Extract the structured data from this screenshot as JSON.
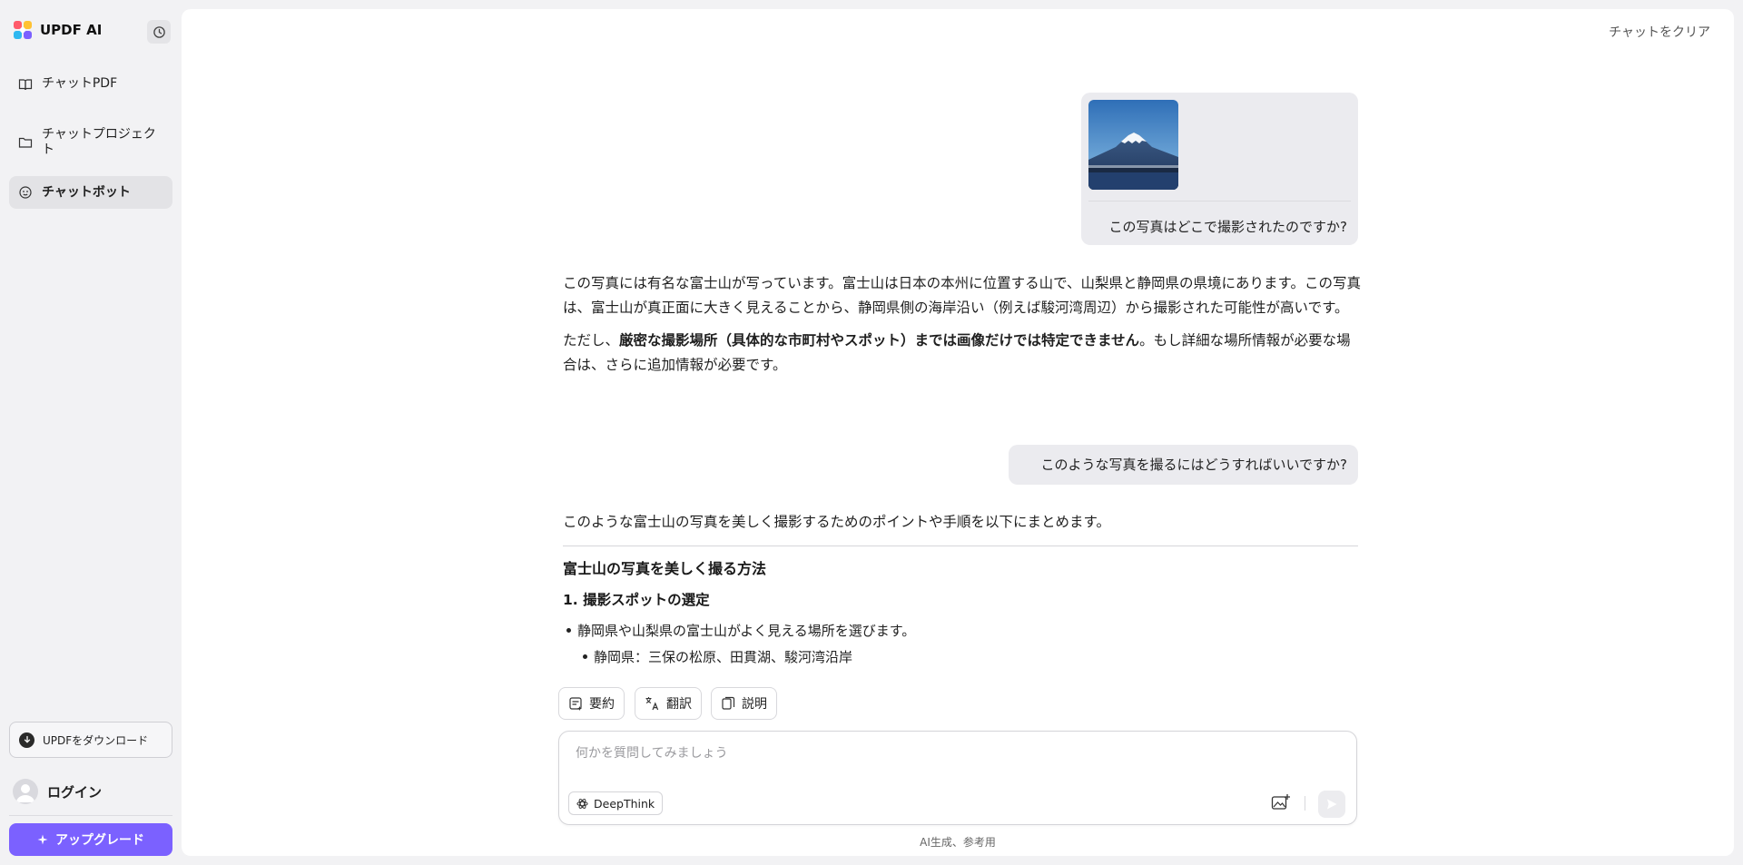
{
  "app": {
    "name": "UPDF AI"
  },
  "sidebar": {
    "items": [
      {
        "label": "チャットPDF",
        "icon": "book-icon"
      },
      {
        "label": "チャットプロジェクト",
        "icon": "folder-icon"
      },
      {
        "label": "チャットボット",
        "icon": "bot-icon",
        "active": true
      }
    ],
    "download_label": "UPDFをダウンロード",
    "login_label": "ログイン",
    "upgrade_label": "アップグレード"
  },
  "header": {
    "clear_label": "チャットをクリア"
  },
  "conversation": {
    "user_message_1": "この写真はどこで撮影されたのですか?",
    "assistant_1": {
      "para1": "この写真には有名な富士山が写っています。富士山は日本の本州に位置する山で、山梨県と静岡県の県境にあります。この写真は、富士山が真正面に大きく見えることから、静岡県側の海岸沿い（例えば駿河湾周辺）から撮影された可能性が高いです。",
      "para2_prefix": "ただし、",
      "para2_bold": "厳密な撮影場所（具体的な市町村やスポット）までは画像だけでは特定できません",
      "para2_suffix": "。もし詳細な場所情報が必要な場合は、さらに追加情報が必要です。"
    },
    "user_message_2": "このような写真を撮るにはどうすればいいですか?",
    "assistant_2": {
      "intro": "このような富士山の写真を美しく撮影するためのポイントや手順を以下にまとめます。",
      "heading": "富士山の写真を美しく撮る方法",
      "subheading": "1. 撮影スポットの選定",
      "bullet1": "静岡県や山梨県の富士山がよく見える場所を選びます。",
      "bullet1_sub": "静岡県：三保の松原、田貫湖、駿河湾沿岸"
    }
  },
  "quick_actions": [
    {
      "label": "要約",
      "icon": "summary-icon"
    },
    {
      "label": "翻訳",
      "icon": "translate-icon"
    },
    {
      "label": "説明",
      "icon": "explain-icon"
    }
  ],
  "composer": {
    "placeholder": "何かを質問してみましょう",
    "value": "",
    "deepthink_label": "DeepThink"
  },
  "footer": {
    "note": "AI生成、参考用"
  },
  "colors": {
    "accent": "#7b61ff",
    "background": "#f2f2f4",
    "panel": "#ffffff",
    "bubble": "#ebebef"
  }
}
